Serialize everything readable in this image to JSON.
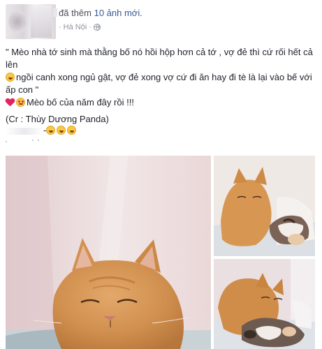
{
  "post": {
    "header_action": "đã thêm",
    "header_count": "10 ảnh mới.",
    "location_prefix": "·",
    "location": "Hà Nội",
    "location_suffix": "·",
    "privacy_icon": "globe-icon"
  },
  "body": {
    "line1": "\" Mèo nhà tớ sinh mà thằng bố nó hồi hộp hơn cả tớ , vợ đẻ thì cứ rối hết cả lên",
    "line2": "ngồi canh xong ngủ gật, vợ đẻ xong vợ cứ đi ăn hay đi tè là lại vào bế với ấp con \"",
    "line3": "Mèo bố của năm đây rồi !!!",
    "credit": "(Cr : Thùy Dương Panda)",
    "tag_suffix": "-"
  },
  "icons": {
    "laugh": "face-with-tears-of-joy-icon",
    "heart": "red-heart-icon",
    "heart_eyes": "heart-eyes-icon"
  },
  "photos": [
    {
      "name": "photo-orange-cat-closeup"
    },
    {
      "name": "photo-cat-with-mother-and-kittens"
    },
    {
      "name": "photo-cat-and-kittens-on-bed"
    }
  ],
  "colors": {
    "link": "#365899",
    "meta": "#90949c",
    "text": "#1d2129"
  }
}
